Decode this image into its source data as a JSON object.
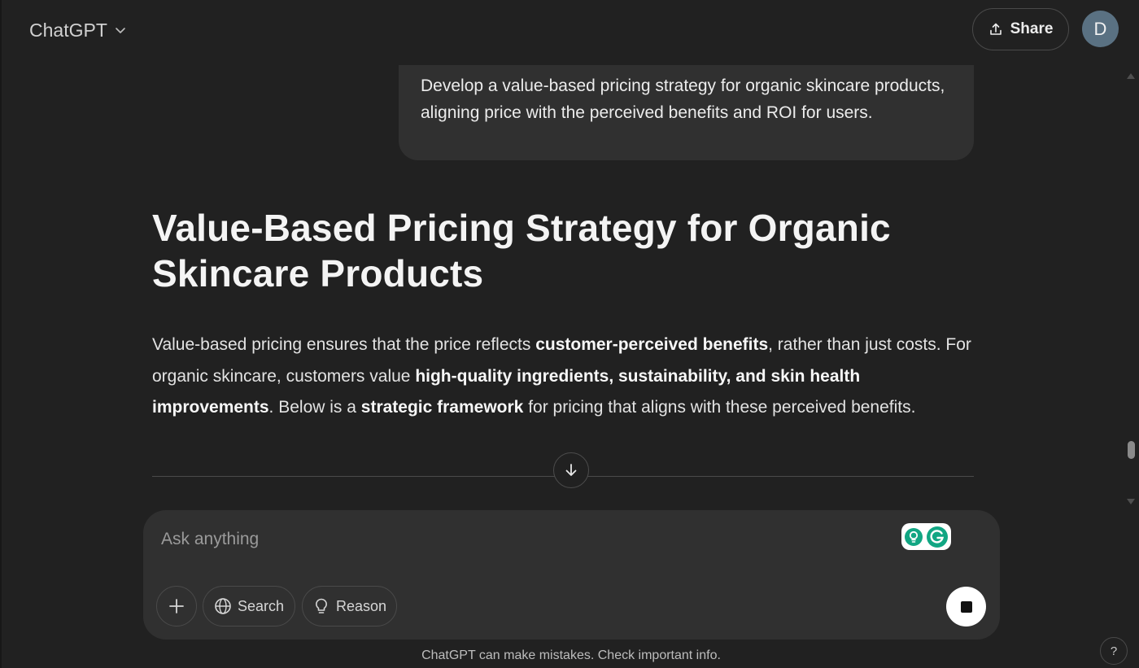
{
  "header": {
    "model_name": "ChatGPT",
    "share_label": "Share",
    "avatar_initial": "D"
  },
  "user_message": "Develop a value-based pricing strategy for organic skincare products, aligning price with the perceived benefits and ROI for users.",
  "answer": {
    "title": "Value-Based Pricing Strategy for Organic Skincare Products",
    "intro": {
      "t1": "Value-based pricing ensures that the price reflects ",
      "b1": "customer-perceived benefits",
      "t2": ", rather than just costs. For organic skincare, customers value ",
      "b2": "high-quality ingredients, sustainability, and skin health improvements",
      "t3": ". Below is a ",
      "b3": "strategic framework",
      "t4": " for pricing that aligns with these perceived benefits."
    }
  },
  "composer": {
    "placeholder": "Ask anything",
    "search_label": "Search",
    "reason_label": "Reason"
  },
  "footer": {
    "disclaimer": "ChatGPT can make mistakes. Check important info.",
    "help_label": "?"
  },
  "colors": {
    "background": "#212121",
    "surface": "#303030",
    "avatar": "#5a7182",
    "text": "#ececec"
  },
  "icons": [
    "chevron-down-icon",
    "share-icon",
    "arrow-down-icon",
    "plus-icon",
    "globe-icon",
    "lightbulb-icon",
    "stop-icon",
    "grammarly-icon"
  ]
}
